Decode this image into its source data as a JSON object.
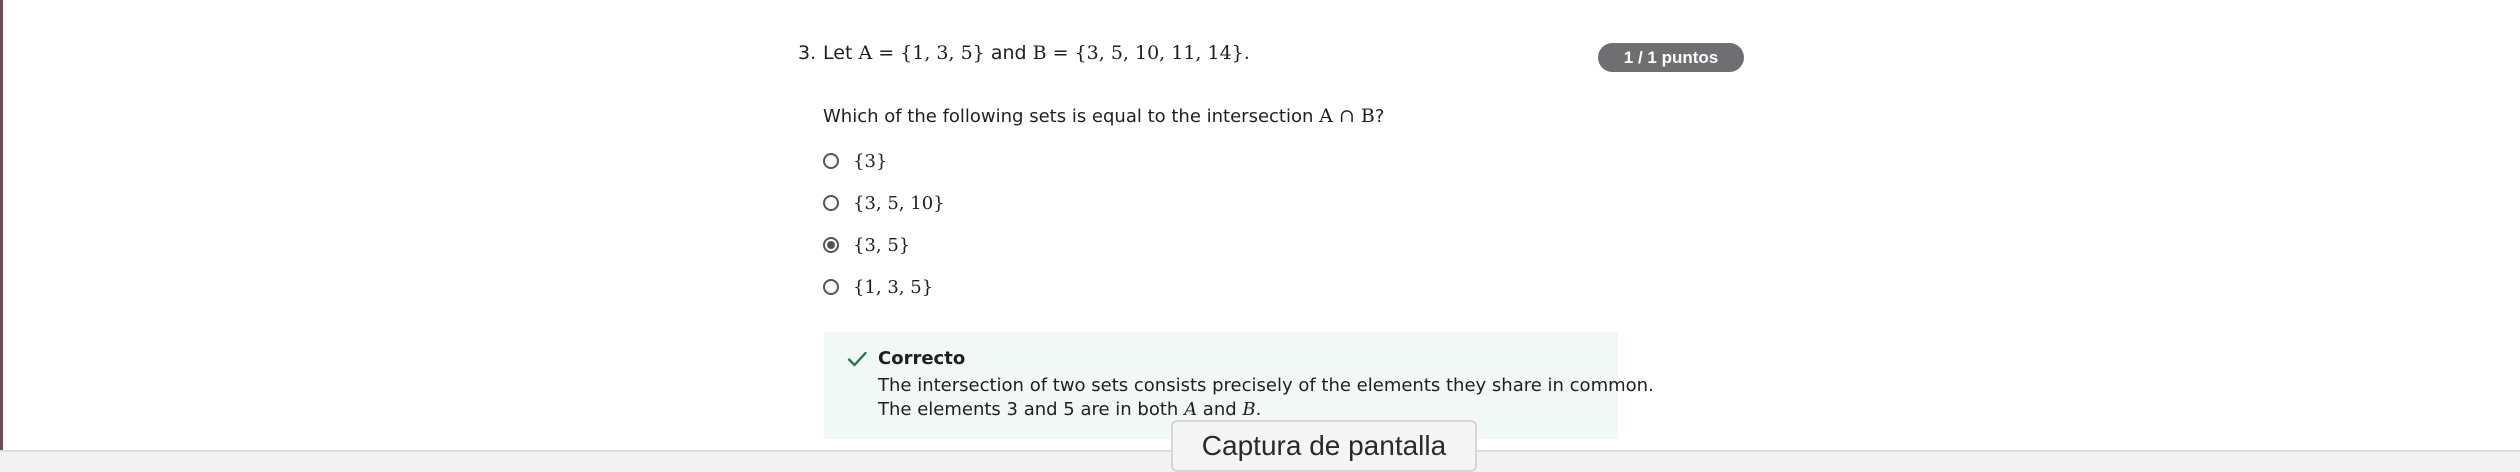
{
  "question": {
    "number": "3.",
    "intro_let": "Let",
    "set_a": "A = {1, 3, 5}",
    "intro_and": "and",
    "set_b": "B = {3, 5, 10, 11, 14}",
    "intro_end": ".",
    "prompt_text": "Which of the following sets is equal to the intersection",
    "prompt_math": "A ∩ B",
    "prompt_end": "?"
  },
  "points_badge": "1 / 1 puntos",
  "options": [
    {
      "label": "{3}",
      "selected": false
    },
    {
      "label": "{3, 5, 10}",
      "selected": false
    },
    {
      "label": "{3, 5}",
      "selected": true
    },
    {
      "label": "{1, 3, 5}",
      "selected": false
    }
  ],
  "feedback": {
    "status": "Correcto",
    "line1": "The intersection of two sets consists precisely of the elements they share in common.",
    "line2_start": "The elements 3 and 5 are in both",
    "line2_a": "A",
    "line2_and": "and",
    "line2_b": "B",
    "line2_end": "."
  },
  "tooltip": "Captura de pantalla",
  "colors": {
    "accent_badge": "#6f6f72",
    "feedback_bg": "#f2f8f6",
    "check_green": "#1e7a4c"
  },
  "icons": {
    "check": "check-icon"
  }
}
